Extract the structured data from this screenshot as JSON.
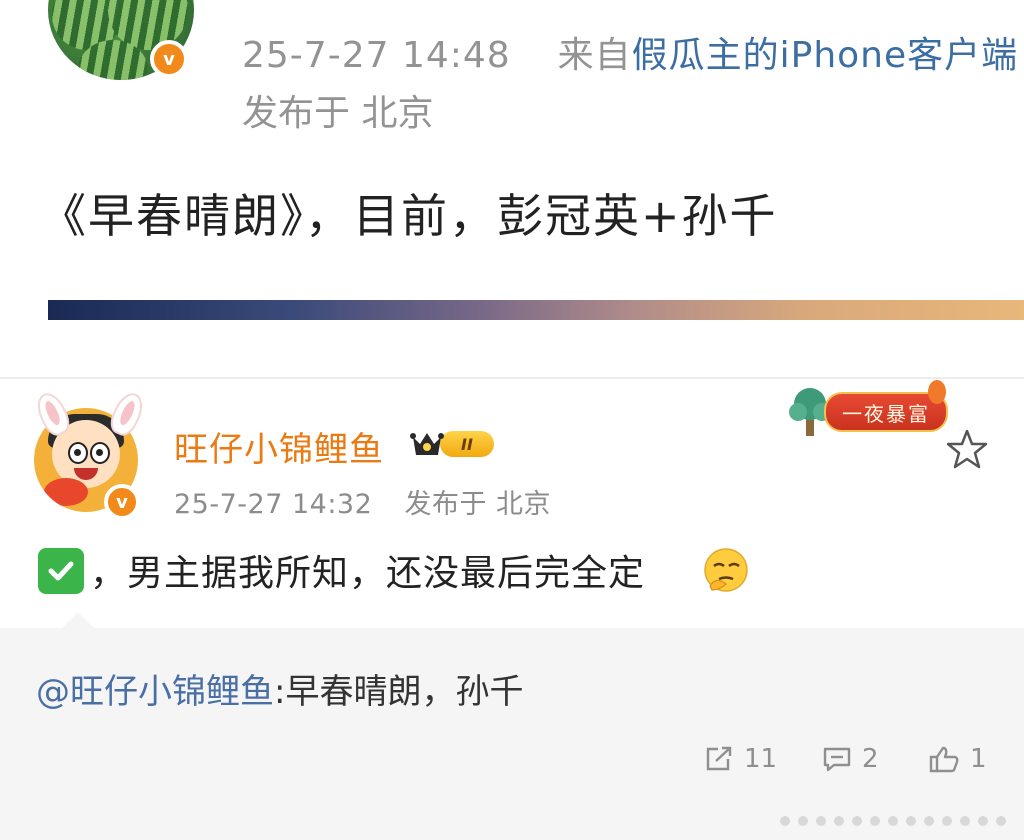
{
  "post1": {
    "timestamp": "25-7-27 14:48",
    "source_prefix": "来自",
    "source": "假瓜主的iPhone客户端",
    "location": "发布于 北京",
    "text": "《早春晴朗》，目前，彭冠英+孙千",
    "verified_badge": "v"
  },
  "post2": {
    "username": "旺仔小锦鲤鱼",
    "vip_level": "II",
    "timestamp": "25-7-27 14:32",
    "location": "发布于 北京",
    "text": "，男主据我所知，还没最后完全定",
    "verified_badge": "v",
    "decoration_label": "一夜暴富",
    "quote": {
      "mention": "@旺仔小锦鲤鱼",
      "text": ":早春晴朗，孙千"
    },
    "actions": {
      "repost_count": "11",
      "comment_count": "2",
      "like_count": "1"
    }
  },
  "colors": {
    "username": "#eb7a13",
    "link": "#3d6ea3",
    "meta": "#939393",
    "badge": "#f28a1b",
    "check": "#3bb54a"
  },
  "icons": [
    "v-badge-icon",
    "vip-crown-icon",
    "star-icon",
    "check-icon",
    "thinking-emoji-icon",
    "repost-icon",
    "comment-icon",
    "like-icon"
  ]
}
